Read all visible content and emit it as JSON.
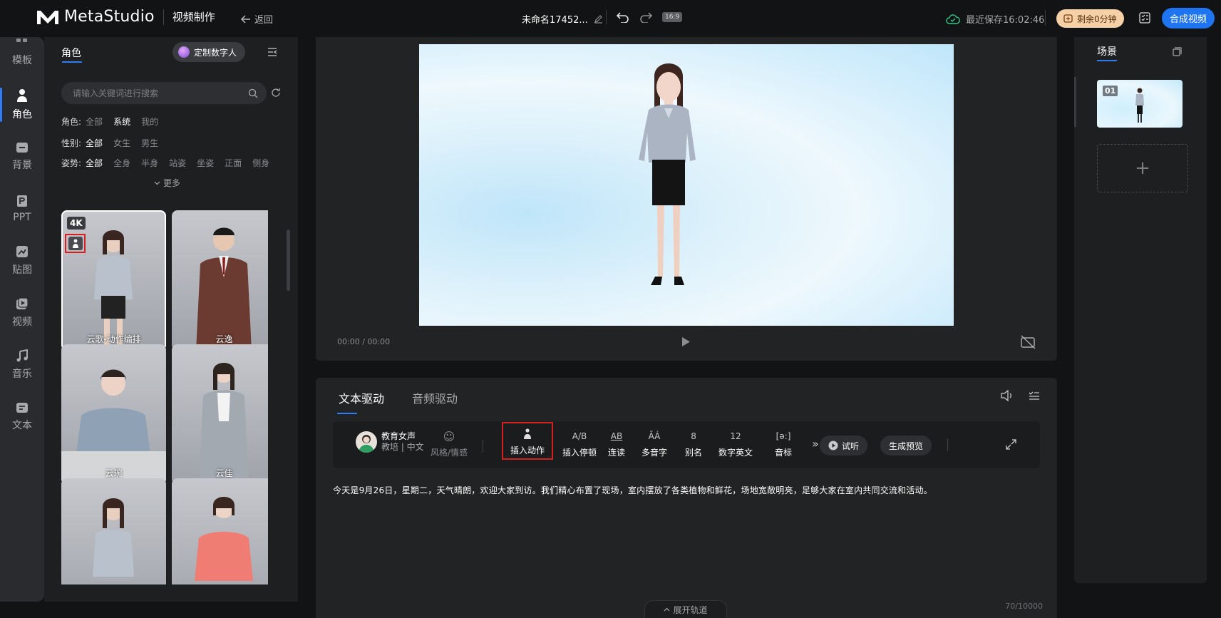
{
  "app": {
    "name": "MetaStudio",
    "section": "视频制作",
    "back_label": "返回"
  },
  "document": {
    "title": "未命名17452...",
    "aspect_ratio": "16:9"
  },
  "status": {
    "saved_text": "最近保存16:02:46",
    "quota_text": "剩余0分钟",
    "compose_label": "合成视频"
  },
  "nav": [
    {
      "label": "模板",
      "icon": "template-icon"
    },
    {
      "label": "角色",
      "icon": "person-icon",
      "active": true
    },
    {
      "label": "背景",
      "icon": "background-icon"
    },
    {
      "label": "PPT",
      "icon": "ppt-icon"
    },
    {
      "label": "贴图",
      "icon": "sticker-icon"
    },
    {
      "label": "视频",
      "icon": "video-icon"
    },
    {
      "label": "音乐",
      "icon": "music-icon"
    },
    {
      "label": "文本",
      "icon": "text-icon"
    }
  ],
  "panel": {
    "tab_label": "角色",
    "custom_button": "定制数字人",
    "search_placeholder": "请输入关键词进行搜索",
    "filters": {
      "role": {
        "label": "角色:",
        "options": [
          "全部",
          "系统",
          "我的"
        ]
      },
      "gender": {
        "label": "性别:",
        "options": [
          "全部",
          "女生",
          "男生"
        ],
        "selected": "全部"
      },
      "pose": {
        "label": "姿势:",
        "options": [
          "全部",
          "全身",
          "半身",
          "站姿",
          "坐姿",
          "正面",
          "侧身"
        ],
        "selected": "全部"
      }
    },
    "more_label": "更多",
    "characters": [
      {
        "name": "云歌-动作编排",
        "badge": "4K",
        "selected": true
      },
      {
        "name": "云逸"
      },
      {
        "name": "云琬"
      },
      {
        "name": "云佳"
      },
      {
        "name": ""
      },
      {
        "name": ""
      }
    ]
  },
  "player": {
    "timecode": "00:00 / 00:00"
  },
  "editor": {
    "tabs": [
      "文本驱动",
      "音频驱动"
    ],
    "voice": {
      "name": "教育女声",
      "subtitle": "教培 | 中文"
    },
    "tools": [
      {
        "label": "风格/情感",
        "glyph": "☺"
      },
      {
        "label": "插入动作",
        "glyph": ""
      },
      {
        "label": "插入停顿",
        "glyph": "A/B"
      },
      {
        "label": "连读",
        "glyph": "AB"
      },
      {
        "label": "多音字",
        "glyph": "ĀÁ"
      },
      {
        "label": "别名",
        "glyph": "8"
      },
      {
        "label": "数字英文",
        "glyph": "12"
      },
      {
        "label": "音标",
        "glyph": "[ə:]"
      }
    ],
    "listen_label": "试听",
    "preview_label": "生成预览",
    "script_text": "今天是9月26日，星期二，天气晴朗，欢迎大家到访。我们精心布置了现场，室内摆放了各类植物和鲜花，场地宽敞明亮，足够大家在室内共同交流和活动。",
    "char_count": "70/10000",
    "track_label": "展开轨道"
  },
  "scenes": {
    "tab_label": "场景",
    "items": [
      {
        "number": "01"
      }
    ],
    "add_label": "+"
  },
  "colors": {
    "accent": "#1f74f0",
    "highlight": "#d61f1f",
    "quota_bg": "#f6d0a6"
  }
}
